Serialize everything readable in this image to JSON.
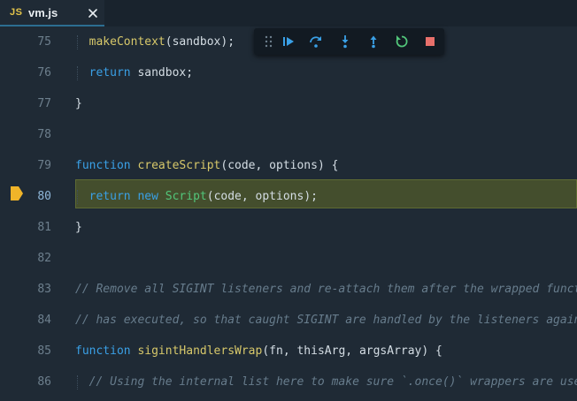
{
  "tab": {
    "lang_badge": "JS",
    "filename": "vm.js",
    "close_icon": "close-icon"
  },
  "debug_toolbar": {
    "buttons": [
      "drag-handle-icon",
      "continue-icon",
      "step-over-icon",
      "step-into-icon",
      "step-out-icon",
      "restart-icon",
      "stop-icon"
    ]
  },
  "lines": [
    {
      "number": "75",
      "text": "  makeContext(sandbox);"
    },
    {
      "number": "76",
      "text": "  return sandbox;"
    },
    {
      "number": "77",
      "text": "}"
    },
    {
      "number": "78",
      "text": ""
    },
    {
      "number": "79",
      "text": "function createScript(code, options) {"
    },
    {
      "number": "80",
      "text": "  return new Script(code, options);"
    },
    {
      "number": "81",
      "text": "}"
    },
    {
      "number": "82",
      "text": ""
    },
    {
      "number": "83",
      "text": "// Remove all SIGINT listeners and re-attach them after the wrapped funct"
    },
    {
      "number": "84",
      "text": "// has executed, so that caught SIGINT are handled by the listeners again"
    },
    {
      "number": "85",
      "text": "function sigintHandlersWrap(fn, thisArg, argsArray) {"
    },
    {
      "number": "86",
      "text": "  // Using the internal list here to make sure `.once()` wrappers are use"
    }
  ],
  "current_line": "80",
  "colors": {
    "keyword": "#3aa0e6",
    "function": "#d7c86a",
    "class": "#52c67a",
    "comment": "#677c8c",
    "highlight": "#444e2d",
    "breakpoint": "#f0b429"
  }
}
